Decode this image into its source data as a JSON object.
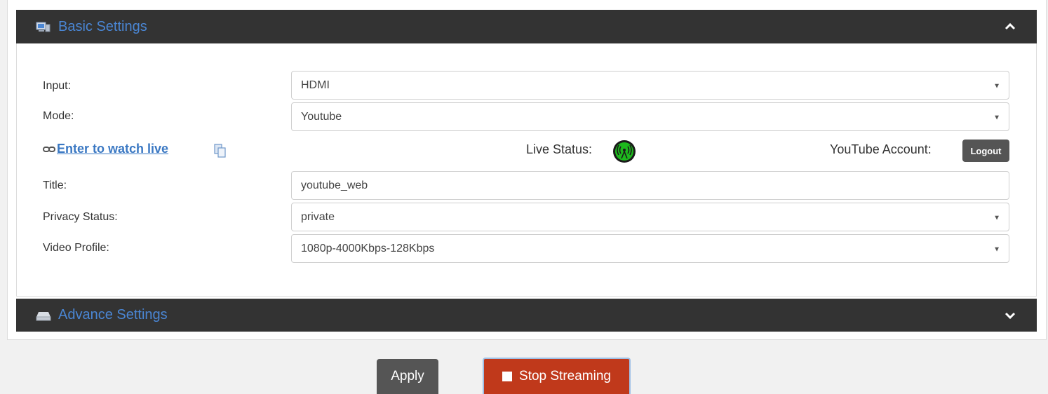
{
  "basic_panel": {
    "title": "Basic Settings",
    "icon": "monitor-icon",
    "toggle_icon": "chevron-up-icon"
  },
  "advance_panel": {
    "title": "Advance Settings",
    "icon": "drive-icon",
    "toggle_icon": "chevron-down-icon"
  },
  "form": {
    "input": {
      "label": "Input:",
      "value": "HDMI"
    },
    "mode": {
      "label": "Mode:",
      "value": "Youtube"
    },
    "title": {
      "label": "Title:",
      "value": "youtube_web"
    },
    "privacy": {
      "label": "Privacy Status:",
      "value": "private"
    },
    "profile": {
      "label": "Video Profile:",
      "value": "1080p-4000Kbps-128Kbps"
    }
  },
  "live": {
    "watch_link": "Enter to watch live",
    "status_label": "Live Status:",
    "account_label": "YouTube Account:",
    "logout_label": "Logout"
  },
  "actions": {
    "apply_label": "Apply",
    "stop_label": "Stop Streaming"
  },
  "colors": {
    "accent": "#4a86d4",
    "header_bg": "#333333",
    "stop": "#c0391b",
    "live_green": "#1db91d"
  }
}
